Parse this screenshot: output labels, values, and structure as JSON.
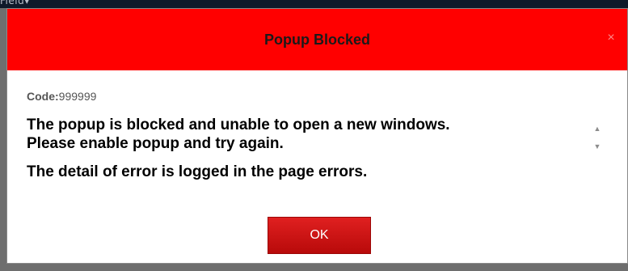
{
  "backdrop": {
    "partial_text": "Field▾"
  },
  "dialog": {
    "title": "Popup Blocked",
    "close_glyph": "×",
    "code_label": "Code:",
    "code_value": "999999",
    "message_line_1": "The popup is blocked and unable to open a new windows.",
    "message_line_2": "Please enable popup and try again.",
    "message_line_3": "The detail of error is logged in the page errors.",
    "ok_label": "OK",
    "scroll_up_glyph": "▲",
    "scroll_down_glyph": "▼"
  },
  "colors": {
    "header": "#ff0000",
    "ok_button": "#cc1010",
    "backdrop": "#6e6e6e"
  },
  "icons": {
    "close": "close-icon",
    "scroll_up": "chevron-up-icon",
    "scroll_down": "chevron-down-icon"
  }
}
